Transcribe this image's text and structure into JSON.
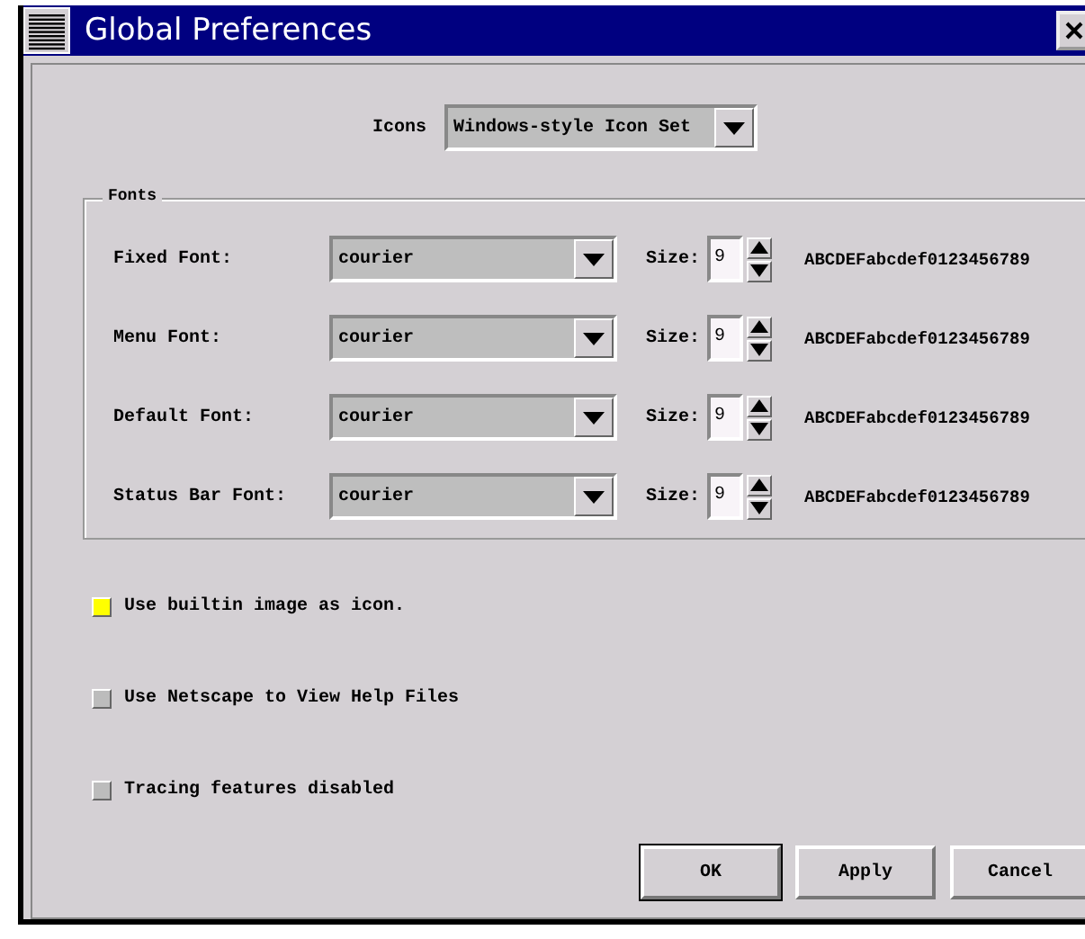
{
  "window": {
    "title": "Global Preferences"
  },
  "icons": {
    "label": "Icons",
    "value": "Windows-style Icon Set"
  },
  "fonts": {
    "title": "Fonts",
    "rows": [
      {
        "label": "Fixed Font:",
        "font": "courier",
        "size_label": "Size:",
        "size": "9",
        "sample": "ABCDEFabcdef0123456789"
      },
      {
        "label": "Menu Font:",
        "font": "courier",
        "size_label": "Size:",
        "size": "9",
        "sample": "ABCDEFabcdef0123456789"
      },
      {
        "label": "Default Font:",
        "font": "courier",
        "size_label": "Size:",
        "size": "9",
        "sample": "ABCDEFabcdef0123456789"
      },
      {
        "label": "Status Bar Font:",
        "font": "courier",
        "size_label": "Size:",
        "size": "9",
        "sample": "ABCDEFabcdef0123456789"
      }
    ]
  },
  "options": [
    {
      "label": "Use builtin image as icon.",
      "checked": true
    },
    {
      "label": "Use Netscape to View Help Files",
      "checked": false
    },
    {
      "label": "Tracing features disabled",
      "checked": false
    }
  ],
  "buttons": [
    {
      "label": "OK",
      "default": true
    },
    {
      "label": "Apply",
      "default": false
    },
    {
      "label": "Cancel",
      "default": false
    }
  ]
}
